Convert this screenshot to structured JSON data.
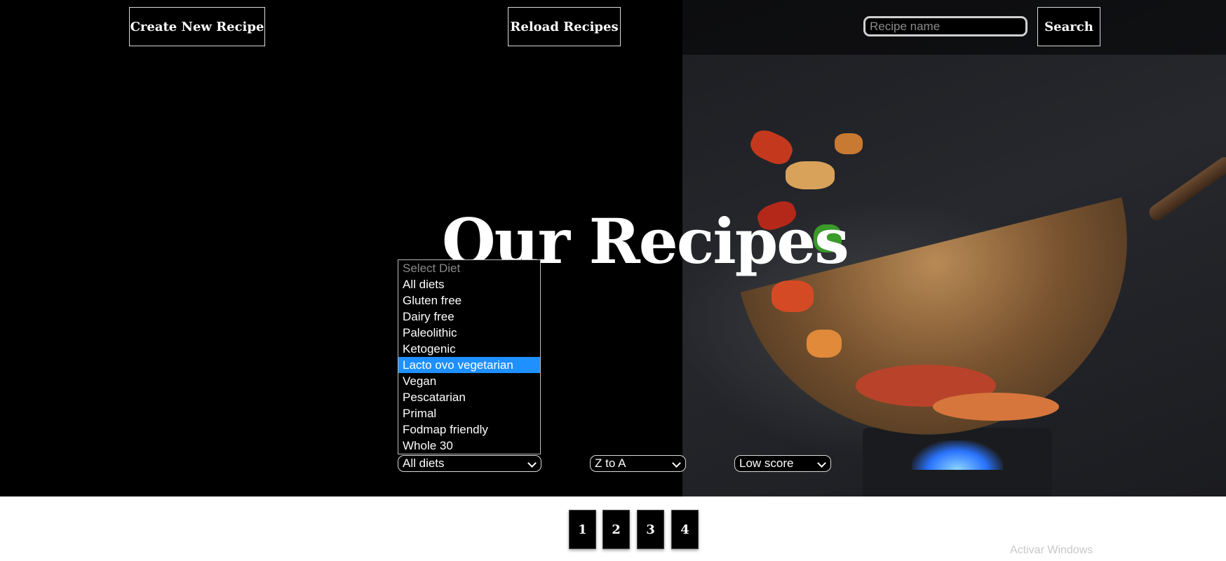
{
  "header": {
    "create_label": "Create New Recipe",
    "reload_label": "Reload Recipes",
    "search_placeholder": "Recipe name",
    "search_value": "",
    "search_label": "Search"
  },
  "hero": {
    "title": "Our Recipes"
  },
  "diet_dropdown": {
    "options": [
      "Select Diet",
      "All diets",
      "Gluten free",
      "Dairy free",
      "Paleolithic",
      "Ketogenic",
      "Lacto ovo vegetarian",
      "Vegan",
      "Pescatarian",
      "Primal",
      "Fodmap friendly",
      "Whole 30"
    ],
    "highlighted": "Lacto ovo vegetarian",
    "selected_value": "All diets"
  },
  "filters": {
    "order_value": "Z to A",
    "score_value": "Low score"
  },
  "pagination": {
    "pages": [
      "1",
      "2",
      "3",
      "4"
    ]
  },
  "os": {
    "watermark": "Activar Windows"
  },
  "colors": {
    "highlight": "#1e90ff",
    "background": "#000000"
  }
}
